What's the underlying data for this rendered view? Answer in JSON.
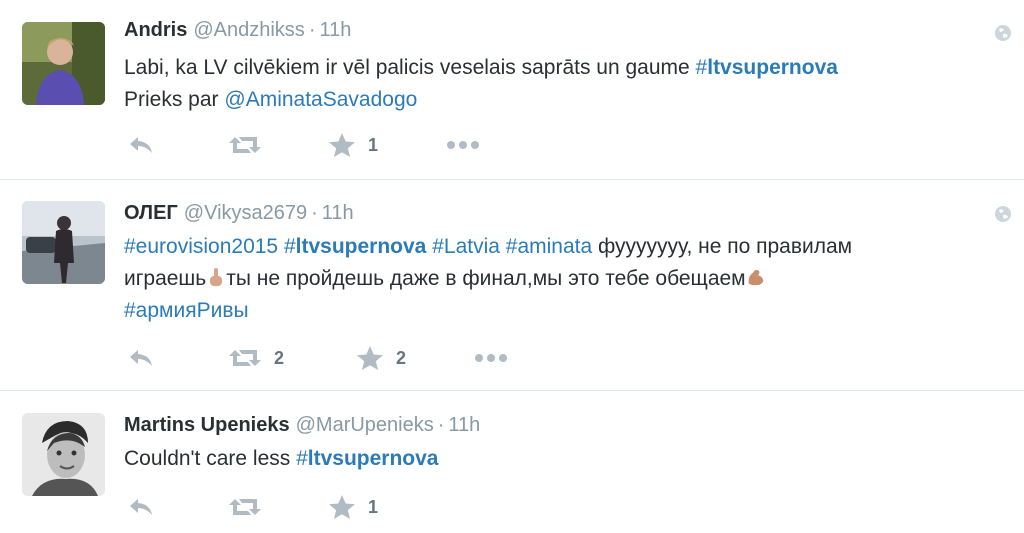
{
  "tweets": [
    {
      "fullname": "Andris",
      "username": "@Andzhikss",
      "separator": "·",
      "time": "11h",
      "lines": [
        [
          {
            "type": "text",
            "value": "Labi, ka LV cilvēkiem ir vēl palicis veselais saprāts un gaume "
          },
          {
            "type": "hashtag",
            "hash": "#",
            "tag": "ltvsupernova"
          }
        ],
        [
          {
            "type": "text",
            "value": "Prieks par "
          },
          {
            "type": "mention",
            "value": "@AminataSavadogo"
          }
        ]
      ],
      "retweets": "",
      "favorites": "1"
    },
    {
      "fullname": "ОЛЕГ",
      "username": "@Vikysa2679",
      "separator": "·",
      "time": "11h",
      "line1_tag1": "#eurovision2015",
      "line1_tag2_hash": "#",
      "line1_tag2": "ltvsupernova",
      "line1_tag3": "#Latvia",
      "line1_tag4": "#aminata",
      "line1_text": " фууууууу, не по правилам",
      "line2_text1": "играешь",
      "line2_text2": "ты не пройдешь даже в финал,мы это тебе обещаем",
      "line3_tag": "#армияРивы",
      "retweets": "2",
      "favorites": "2"
    },
    {
      "fullname": "Martins Upenieks",
      "username": "@MarUpenieks",
      "separator": "·",
      "time": "11h",
      "text": "Couldn't care less ",
      "tag_hash": "#",
      "tag": "ltvsupernova",
      "retweets": "",
      "favorites": "1"
    }
  ],
  "icons": {
    "reply": "reply-icon",
    "retweet": "retweet-icon",
    "favorite": "star-icon",
    "more": "more-dots-icon",
    "geo": "globe-icon"
  },
  "colors": {
    "link": "#2b7bb9",
    "muted": "#8899a6",
    "action": "#b1bbc3",
    "divider": "#e1e8ed"
  }
}
